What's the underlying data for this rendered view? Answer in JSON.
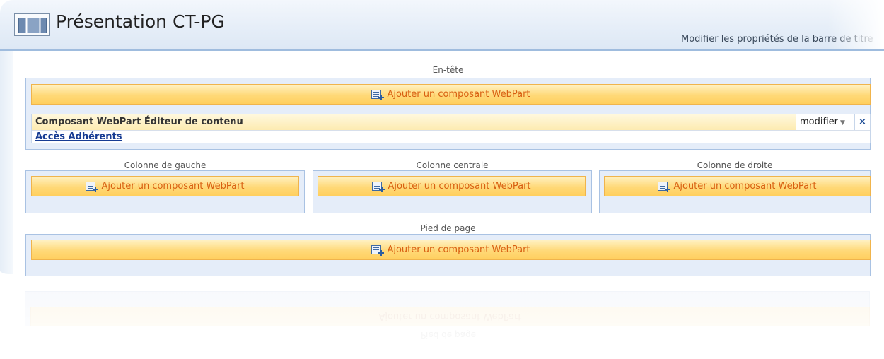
{
  "window": {
    "title": "Présentation CT-PG",
    "edit_title_link": "Modifier les propriétés de la barre de titre"
  },
  "zones": {
    "header": {
      "label": "En-tête",
      "add_label": "Ajouter un composant WebPart",
      "webpart": {
        "title": "Composant WebPart Éditeur de contenu",
        "menu_label": "modifier",
        "close_glyph": "×",
        "content_link": "Accès Adhérents"
      }
    },
    "left": {
      "label": "Colonne de gauche",
      "add_label": "Ajouter un composant WebPart"
    },
    "center": {
      "label": "Colonne centrale",
      "add_label": "Ajouter un composant WebPart"
    },
    "right": {
      "label": "Colonne de droite",
      "add_label": "Ajouter un composant WebPart"
    },
    "footer": {
      "label": "Pied de page",
      "add_label": "Ajouter un composant WebPart"
    }
  },
  "icons": {
    "page_icon": "layout-page-icon",
    "add_webpart_icon": "add-webpart-icon",
    "dropdown_icon": "chevron-down-icon",
    "close_icon": "close-icon"
  },
  "colors": {
    "button_fill": "#ffd978",
    "button_text": "#d85f11",
    "zone_fill": "#e5edf9",
    "link": "#173c93"
  }
}
